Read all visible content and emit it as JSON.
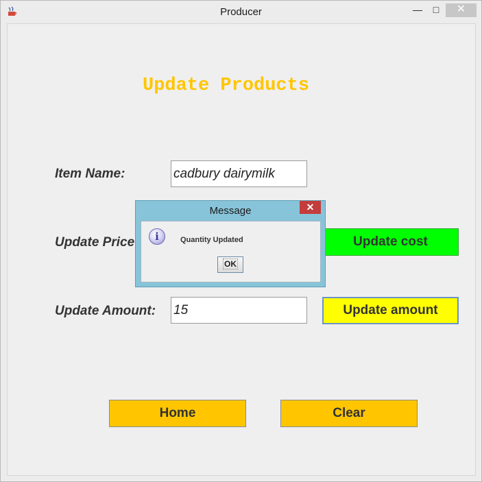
{
  "window": {
    "title": "Producer",
    "minimize_glyph": "—",
    "maximize_glyph": "□",
    "close_glyph": "✕",
    "app_icon": "java-cup-icon"
  },
  "form": {
    "heading": "Update Products",
    "item_name_label": "Item Name:",
    "item_name_value": "cadbury dairymilk",
    "price_label": "Update Price:",
    "update_cost_label": "Update cost",
    "amount_label": "Update Amount:",
    "amount_value": "15",
    "update_amount_label": "Update amount",
    "home_label": "Home",
    "clear_label": "Clear"
  },
  "dialog": {
    "title": "Message",
    "close_glyph": "✕",
    "icon": "info-icon",
    "icon_glyph": "i",
    "message": "Quantity Updated",
    "ok_label": "OK"
  },
  "colors": {
    "heading": "#ffc600",
    "update_cost_bg": "#00ff00",
    "update_amount_bg": "#ffff00",
    "nav_button_bg": "#ffc600",
    "dialog_frame": "#88c4d9",
    "dialog_close": "#c43c3c"
  }
}
